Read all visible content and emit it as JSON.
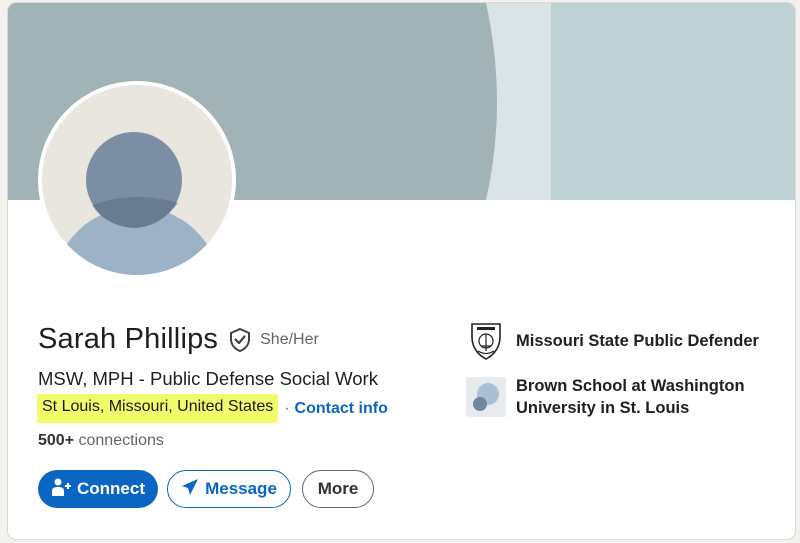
{
  "profile": {
    "name": "Sarah Phillips",
    "pronouns": "She/Her",
    "headline": "MSW, MPH - Public Defense Social Work",
    "location": "St Louis, Missouri, United States",
    "separator": "·",
    "contact_info": "Contact info",
    "connections_count": "500+",
    "connections_label": "connections"
  },
  "actions": {
    "connect": "Connect",
    "message": "Message",
    "more": "More"
  },
  "organizations": [
    {
      "name": "Missouri State Public Defender",
      "icon": "state-seal-icon"
    },
    {
      "name": "Brown School at Washington University in St. Louis",
      "icon": "school-logo-icon"
    }
  ],
  "colors": {
    "primary": "#0a66c2",
    "location_highlight": "#f2fc6a",
    "banner_main": "#a2b3b7",
    "banner_light": "#dae3e5",
    "banner_right": "#bed2d5"
  }
}
